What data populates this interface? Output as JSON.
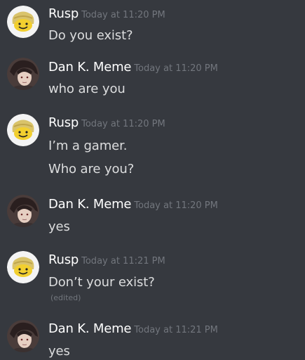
{
  "messages": [
    {
      "author": "Rusp",
      "avatar": "smiley-hardhat-avatar",
      "timestamp": "Today at 11:20 PM",
      "lines": [
        "Do you exist?"
      ]
    },
    {
      "author": "Dan K. Meme",
      "avatar": "anime-portrait-avatar",
      "timestamp": "Today at 11:20 PM",
      "lines": [
        "who are you"
      ]
    },
    {
      "author": "Rusp",
      "avatar": "smiley-hardhat-avatar",
      "timestamp": "Today at 11:20 PM",
      "lines": [
        "I’m a gamer.",
        "Who are you?"
      ]
    },
    {
      "author": "Dan K. Meme",
      "avatar": "anime-portrait-avatar",
      "timestamp": "Today at 11:20 PM",
      "lines": [
        "yes"
      ]
    },
    {
      "author": "Rusp",
      "avatar": "smiley-hardhat-avatar",
      "timestamp": "Today at 11:21 PM",
      "lines": [
        "Don’t your exist?"
      ],
      "edited_label": "(edited)"
    },
    {
      "author": "Dan K. Meme",
      "avatar": "anime-portrait-avatar",
      "timestamp": "Today at 11:21 PM",
      "lines": [
        "yes"
      ]
    }
  ],
  "colors": {
    "background": "#36393f",
    "author": "#ffffff",
    "message_text": "#dcddde",
    "timestamp": "#72767d"
  }
}
